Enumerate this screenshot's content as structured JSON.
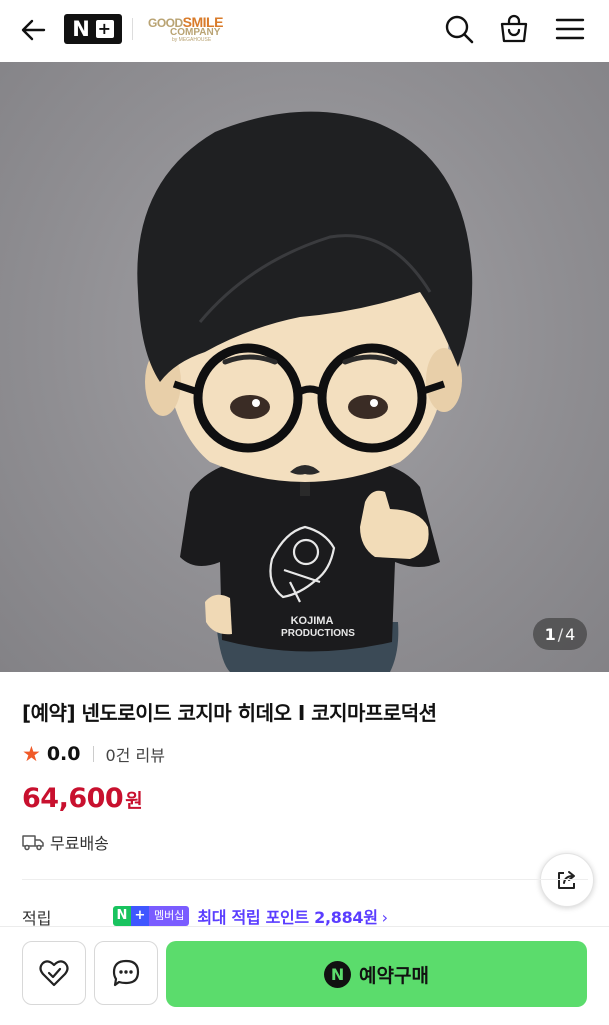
{
  "header": {
    "icons": [
      "back-arrow-icon",
      "search-icon",
      "shopping-bag-icon",
      "menu-icon"
    ],
    "nplus_logo": {
      "n": "N",
      "plus": "+"
    },
    "brand_logo": {
      "line1_a": "GOOD",
      "line1_b": "SMILE",
      "line2": "COMPANY",
      "line3": "by MEGAHOUSE"
    }
  },
  "image": {
    "current": "1",
    "separator": "/",
    "total": "4",
    "shirt_text_line1": "KOJIMA",
    "shirt_text_line2": "PRODUCTIONS"
  },
  "product": {
    "title": "[예약] 넨도로이드 코지마 히데오 I 코지마프로덕션",
    "star": "★",
    "rating": "0.0",
    "review_count": "0건 리뷰",
    "price": "64,600",
    "currency": "원",
    "shipping": "무료배송"
  },
  "points": {
    "label": "적립",
    "badge_n": "N",
    "badge_plus": "+",
    "badge_member": "멤버십",
    "text": "최대 적립 포인트 2,884원",
    "arrow": "›"
  },
  "bottom": {
    "buy_badge": "N",
    "buy_label": "예약구매"
  },
  "colors": {
    "price": "#c8102e",
    "buy_button": "#5bdc6c",
    "points_text": "#5a3dff",
    "star": "#f05a28"
  }
}
